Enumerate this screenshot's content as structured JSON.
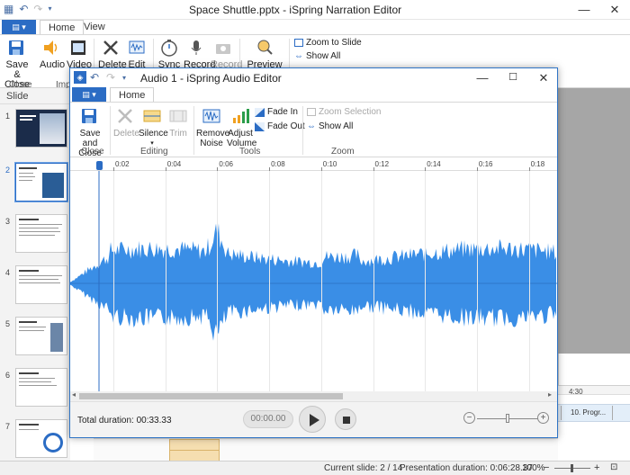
{
  "outer": {
    "title": "Space Shuttle.pptx - iSpring Narration Editor",
    "tabs": [
      "Home",
      "View"
    ],
    "ribbon": {
      "save_close": "Save &\nClose",
      "audio": "Audio",
      "video": "Video",
      "delete": "Delete",
      "edit": "Edit",
      "sync": "Sync",
      "record": "Record",
      "record_disabled": "Record",
      "preview": "Preview with",
      "zoom_to_slide": "Zoom to Slide",
      "show_all": "Show All",
      "group_close": "Close",
      "group_import": "Imp"
    },
    "thumbs_header": "Slide Thumbnails",
    "thumb_numbers": [
      "1",
      "2",
      "3",
      "4",
      "5",
      "6",
      "7"
    ],
    "timeline": {
      "time_label": "4:30",
      "clip_label": "10. Progr..."
    },
    "status": {
      "current_slide": "Current slide: 2 / 14",
      "presentation_duration": "Presentation duration: 0:06:28.37",
      "zoom": "100%"
    }
  },
  "audio_editor": {
    "title": "Audio 1 - iSpring Audio Editor",
    "tab_home": "Home",
    "ribbon": {
      "save_close": "Save and\nClose",
      "delete": "Delete",
      "silence": "Silence",
      "trim": "Trim",
      "remove_noise": "Remove\nNoise",
      "adjust_volume": "Adjust\nVolume",
      "fade_in": "Fade In",
      "fade_out": "Fade Out",
      "zoom_selection": "Zoom Selection",
      "show_all": "Show All",
      "group_close": "Close",
      "group_editing": "Editing",
      "group_tools": "Tools",
      "group_zoom": "Zoom"
    },
    "ruler_labels": [
      "0:02",
      "0:04",
      "0:06",
      "0:08",
      "0:10",
      "0:12",
      "0:14",
      "0:16",
      "0:18"
    ],
    "total_duration": "Total duration: 00:33.33",
    "current_time": "00:00.00",
    "waveform_color": "#3a8ee6"
  },
  "colors": {
    "accent": "#2b6cc4",
    "waveform": "#3a8ee6"
  }
}
